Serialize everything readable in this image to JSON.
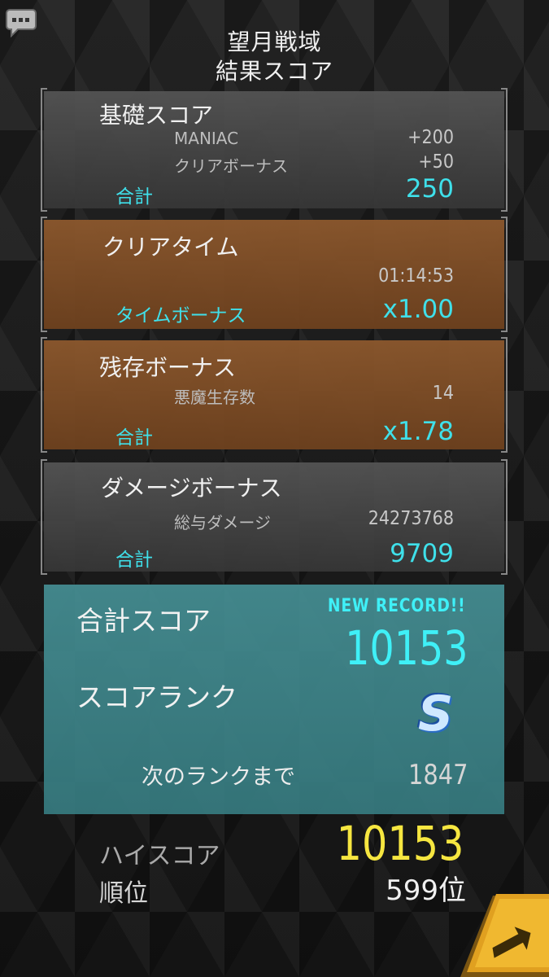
{
  "header": {
    "stage_name": "望月戦域",
    "screen_title": "結果スコア"
  },
  "base_score": {
    "title": "基礎スコア",
    "items": [
      {
        "label": "MANIAC",
        "value": "+200"
      },
      {
        "label": "クリアボーナス",
        "value": "+50"
      }
    ],
    "total_label": "合計",
    "total_value": "250"
  },
  "clear_time": {
    "title": "クリアタイム",
    "time": "01:14:53",
    "bonus_label": "タイムボーナス",
    "bonus_value": "x1.00"
  },
  "survival_bonus": {
    "title": "残存ボーナス",
    "item_label": "悪魔生存数",
    "item_value": "14",
    "total_label": "合計",
    "total_value": "x1.78"
  },
  "damage_bonus": {
    "title": "ダメージボーナス",
    "item_label": "総与ダメージ",
    "item_value": "24273768",
    "total_label": "合計",
    "total_value": "9709"
  },
  "summary": {
    "total_label": "合計スコア",
    "new_record": "NEW RECORD!!",
    "total_value": "10153",
    "rank_label": "スコアランク",
    "rank": "S",
    "next_label": "次のランクまで",
    "next_value": "1847"
  },
  "high_score": {
    "label": "ハイスコア",
    "value": "10153",
    "ranking_label": "順位",
    "ranking_value": "599位"
  },
  "colors": {
    "accent_cyan": "#3fe0ea",
    "highscore_yellow": "#f6e640",
    "orange_panel": "#8c582d",
    "teal_panel": "#46919a",
    "next_button": "#e0a020"
  },
  "icons": {
    "chat": "chat-bubble-icon",
    "next": "next-arrow-icon"
  }
}
